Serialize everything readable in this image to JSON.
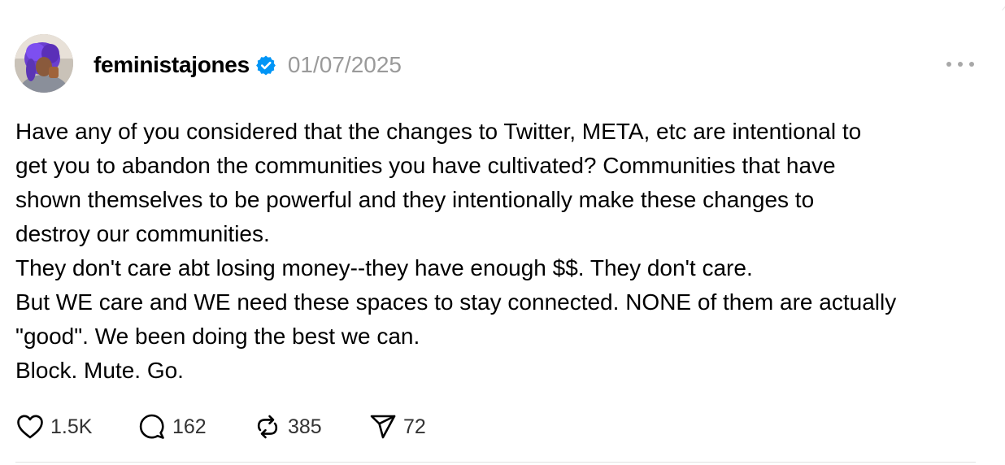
{
  "post": {
    "author": {
      "username": "feministajones",
      "verified": true
    },
    "date": "01/07/2025",
    "more_menu_icon": "ellipsis-icon",
    "body_lines": [
      "Have any of you considered that the changes to Twitter, META, etc are intentional to",
      "get you to abandon the communities you have cultivated? Communities that have",
      "shown themselves to be powerful and they intentionally make these changes to",
      "destroy our communities.",
      "They don't care abt losing money--they have enough $$. They don't care.",
      "But WE care and WE need these spaces to stay connected. NONE of them are actually",
      "\"good\". We been doing the best we can.",
      "Block. Mute. Go."
    ],
    "actions": {
      "likes": "1.5K",
      "replies": "162",
      "reposts": "385",
      "shares": "72"
    }
  },
  "colors": {
    "verified_badge": "#0095f6",
    "secondary_text": "#9a9a9a",
    "icon": "#000000"
  }
}
